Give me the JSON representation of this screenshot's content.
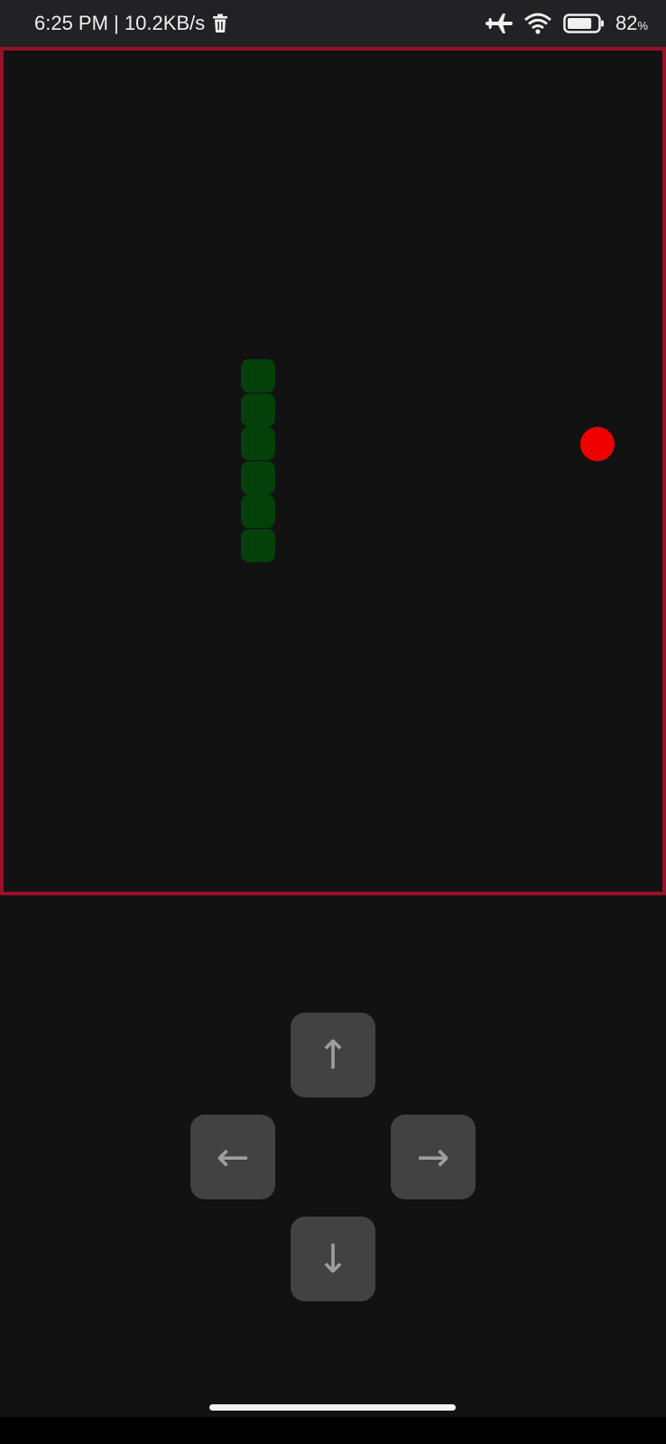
{
  "status_bar": {
    "time_speed": "6:25 PM | 10.2KB/s",
    "battery_percent": "82",
    "battery_unit": "%",
    "battery_level": 0.82,
    "icons": [
      "trash-icon",
      "airplane-mode-icon",
      "wifi-icon",
      "battery-icon"
    ]
  },
  "game": {
    "border_color": "#9b0f27",
    "snake_color": "#044009",
    "food_color": "#ee0000",
    "background_color": "#121213",
    "snake_length": 6,
    "snake_direction": "vertical"
  },
  "controls": {
    "up": "↑",
    "left": "←",
    "right": "→",
    "down": "↓"
  }
}
